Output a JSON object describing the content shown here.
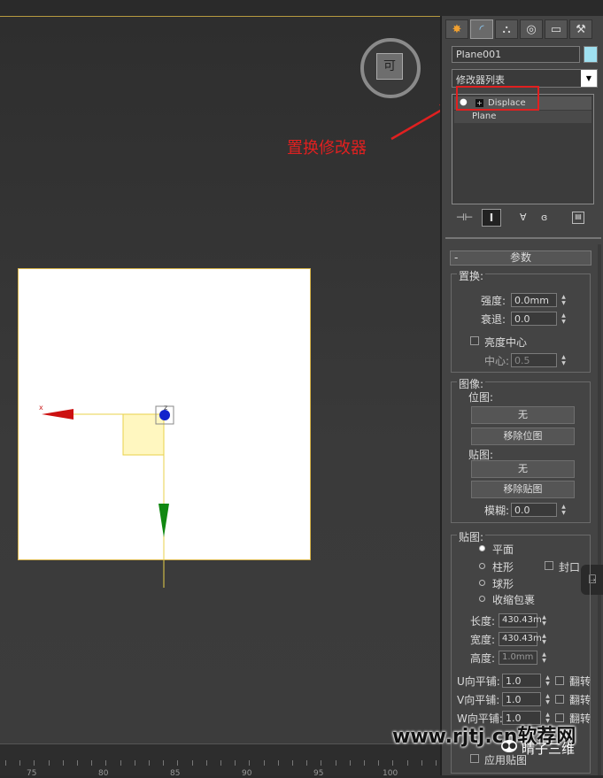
{
  "panel": {
    "object_name": "Plane001",
    "object_color": "#9fe0f0",
    "modifier_list_label": "修改器列表",
    "stack_items": [
      "Displace",
      "Plane"
    ],
    "rollout_title": "参数",
    "displace_group": {
      "title": "置换:",
      "strength_label": "强度:",
      "strength_value": "0.0mm",
      "decay_label": "衰退:",
      "decay_value": "0.0",
      "luminance_center_label": "亮度中心",
      "center_label": "中心:",
      "center_value": "0.5"
    },
    "image_group": {
      "title": "图像:",
      "bitmap_label": "位图:",
      "bitmap_button": "无",
      "remove_bitmap_button": "移除位图",
      "map_label": "贴图:",
      "map_button": "无",
      "remove_map_button": "移除贴图",
      "blur_label": "模糊:",
      "blur_value": "0.0"
    },
    "map_group": {
      "title": "贴图:",
      "options": [
        "平面",
        "柱形",
        "球形",
        "收缩包裹"
      ],
      "cap_label": "封口",
      "length_label": "长度:",
      "length_value": "430.43m",
      "width_label": "宽度:",
      "width_value": "430.43m",
      "height_label": "高度:",
      "height_value": "1.0mm",
      "u_tile_label": "U向平铺:",
      "u_tile_value": "1.0",
      "v_tile_label": "V向平铺:",
      "v_tile_value": "1.0",
      "w_tile_label": "W向平铺:",
      "w_tile_value": "1.0",
      "flip_label": "翻转",
      "apply_map_label": "应用贴图"
    }
  },
  "annotation": {
    "label": "置换修改器",
    "color": "#e02020"
  },
  "viewcube": {
    "face_label": "可"
  },
  "gizmo": {
    "x_label": "x",
    "z_label": "z"
  },
  "ruler": {
    "labels": [
      "75",
      "80",
      "85",
      "90",
      "95",
      "100"
    ]
  },
  "watermark": {
    "site": "www.rjtj.cn软荐网",
    "account": "晴子三维"
  }
}
